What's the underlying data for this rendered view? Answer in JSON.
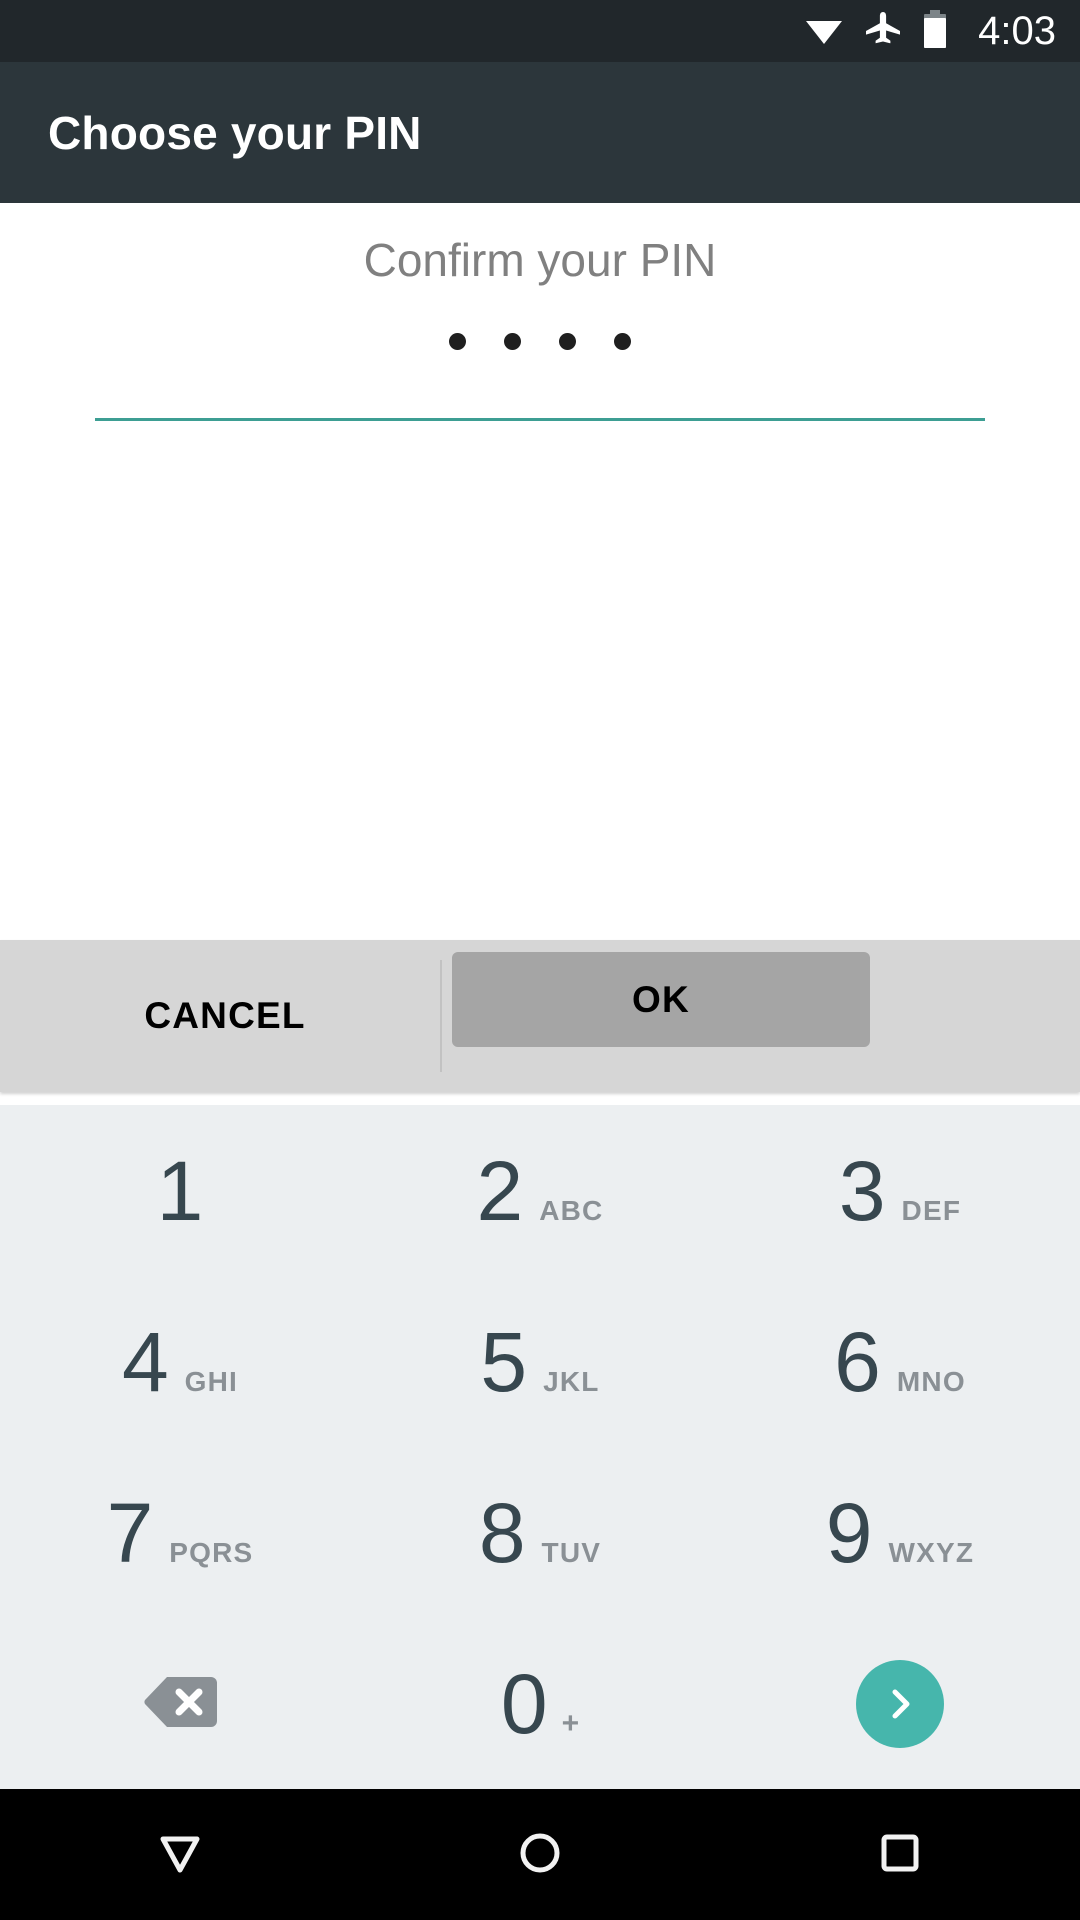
{
  "status_bar": {
    "time": "4:03",
    "icons": [
      {
        "name": "wifi-icon",
        "label": "wifi"
      },
      {
        "name": "airplane-mode-icon",
        "label": "airplane mode"
      },
      {
        "name": "battery-icon",
        "label": "battery"
      }
    ]
  },
  "app_bar": {
    "title": "Choose your PIN"
  },
  "pin_entry": {
    "prompt": "Confirm your PIN",
    "entered_digits": 4,
    "underline_color": "#3d9e93"
  },
  "actions": {
    "cancel_label": "CANCEL",
    "ok_label": "OK"
  },
  "keypad": {
    "rows": [
      [
        {
          "num": "1",
          "letters": ""
        },
        {
          "num": "2",
          "letters": "ABC"
        },
        {
          "num": "3",
          "letters": "DEF"
        }
      ],
      [
        {
          "num": "4",
          "letters": "GHI"
        },
        {
          "num": "5",
          "letters": "JKL"
        },
        {
          "num": "6",
          "letters": "MNO"
        }
      ],
      [
        {
          "num": "7",
          "letters": "PQRS"
        },
        {
          "num": "8",
          "letters": "TUV"
        },
        {
          "num": "9",
          "letters": "WXYZ"
        }
      ]
    ],
    "bottom_row": {
      "backspace_icon": "backspace-icon",
      "zero": {
        "num": "0",
        "letters": "+"
      },
      "enter_icon": "chevron-right-icon",
      "enter_color": "#46b6ac"
    }
  },
  "nav_bar": {
    "back": "back-triangle-icon",
    "home": "home-circle-icon",
    "recents": "recents-square-icon"
  }
}
